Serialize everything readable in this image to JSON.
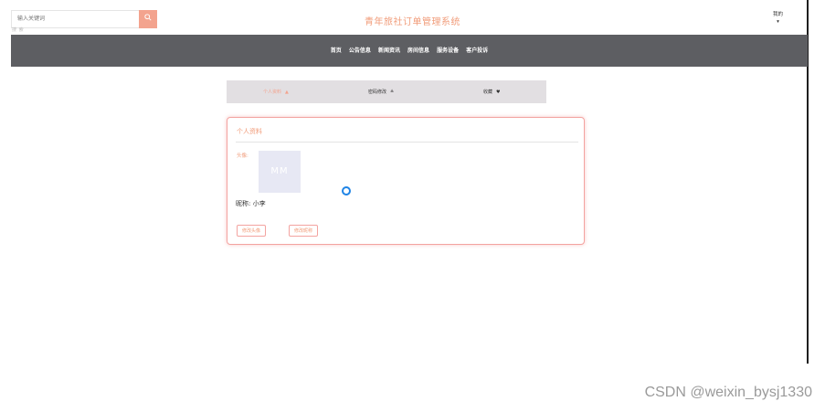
{
  "header": {
    "search_placeholder": "输入关键词",
    "search_sub": "搜 索",
    "search_icon": "search-icon",
    "site_title": "青年旅社订单管理系统",
    "user_menu_label": "我的",
    "user_menu_caret": "▾"
  },
  "nav": {
    "items": [
      {
        "label": "首页"
      },
      {
        "label": "公告信息"
      },
      {
        "label": "新闻资讯"
      },
      {
        "label": "房间信息"
      },
      {
        "label": "服务设备"
      },
      {
        "label": "客户投诉"
      }
    ]
  },
  "subtabs": {
    "items": [
      {
        "label": "个人资料",
        "icon": "▲",
        "icon_name": "user-icon"
      },
      {
        "label": "密码修改",
        "icon": "≜",
        "icon_name": "lock-icon"
      },
      {
        "label": "收藏",
        "icon": "♥",
        "icon_name": "heart-icon"
      }
    ],
    "active_index": 0
  },
  "profile": {
    "title": "个人资料",
    "avatar_label": "头像:",
    "avatar_text": "MM",
    "nickname_label": "昵称: ",
    "nickname_value": "小李",
    "change_avatar_button": "修改头像",
    "change_nickname_button": "修改昵称"
  },
  "watermark": "CSDN @weixin_bysj1330",
  "colors": {
    "accent": "#f19c7a",
    "nav_bg": "#5d5e62",
    "subtab_bg": "#e2dfe2",
    "card_border": "#f3a3a0",
    "search_btn": "#f3a38e"
  }
}
